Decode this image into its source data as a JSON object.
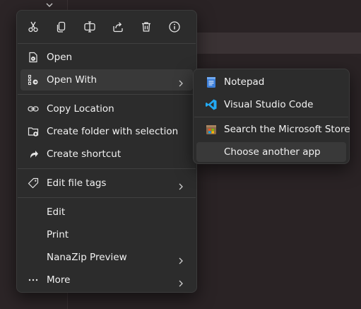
{
  "colors": {
    "menu_bg": "#2c2c2c",
    "highlight": "#393939",
    "text": "#f2f2f2",
    "icon": "#e6e6e6",
    "vscode_blue": "#23a9f2",
    "notepad_blue": "#3d7fd9"
  },
  "toolbar": {
    "buttons": [
      {
        "name": "Cut",
        "icon": "scissors-icon"
      },
      {
        "name": "Copy",
        "icon": "copy-icon"
      },
      {
        "name": "Rename",
        "icon": "rename-icon"
      },
      {
        "name": "Share",
        "icon": "share-icon"
      },
      {
        "name": "Delete",
        "icon": "trash-icon"
      },
      {
        "name": "Properties",
        "icon": "info-icon"
      }
    ]
  },
  "menu": {
    "open": {
      "label": "Open",
      "icon": "open-file-icon"
    },
    "open_with": {
      "label": "Open With",
      "icon": "open-with-icon",
      "has_submenu": true
    },
    "copy_location": {
      "label": "Copy Location",
      "icon": "link-icon"
    },
    "create_folder": {
      "label": "Create folder with selection",
      "icon": "folder-add-icon"
    },
    "create_shortcut": {
      "label": "Create shortcut",
      "icon": "shortcut-icon"
    },
    "edit_tags": {
      "label": "Edit file tags",
      "icon": "tag-icon",
      "has_submenu": true
    },
    "edit": {
      "label": "Edit"
    },
    "print": {
      "label": "Print"
    },
    "nanazip": {
      "label": "NanaZip Preview",
      "has_submenu": true
    },
    "more": {
      "label": "More",
      "icon": "ellipsis-icon",
      "has_submenu": true
    }
  },
  "submenu": {
    "items": [
      {
        "label": "Notepad",
        "icon": "notepad-icon"
      },
      {
        "label": "Visual Studio Code",
        "icon": "vscode-icon"
      },
      {
        "label": "Search the Microsoft Store",
        "icon": "store-icon"
      },
      {
        "label": "Choose another app"
      }
    ]
  }
}
